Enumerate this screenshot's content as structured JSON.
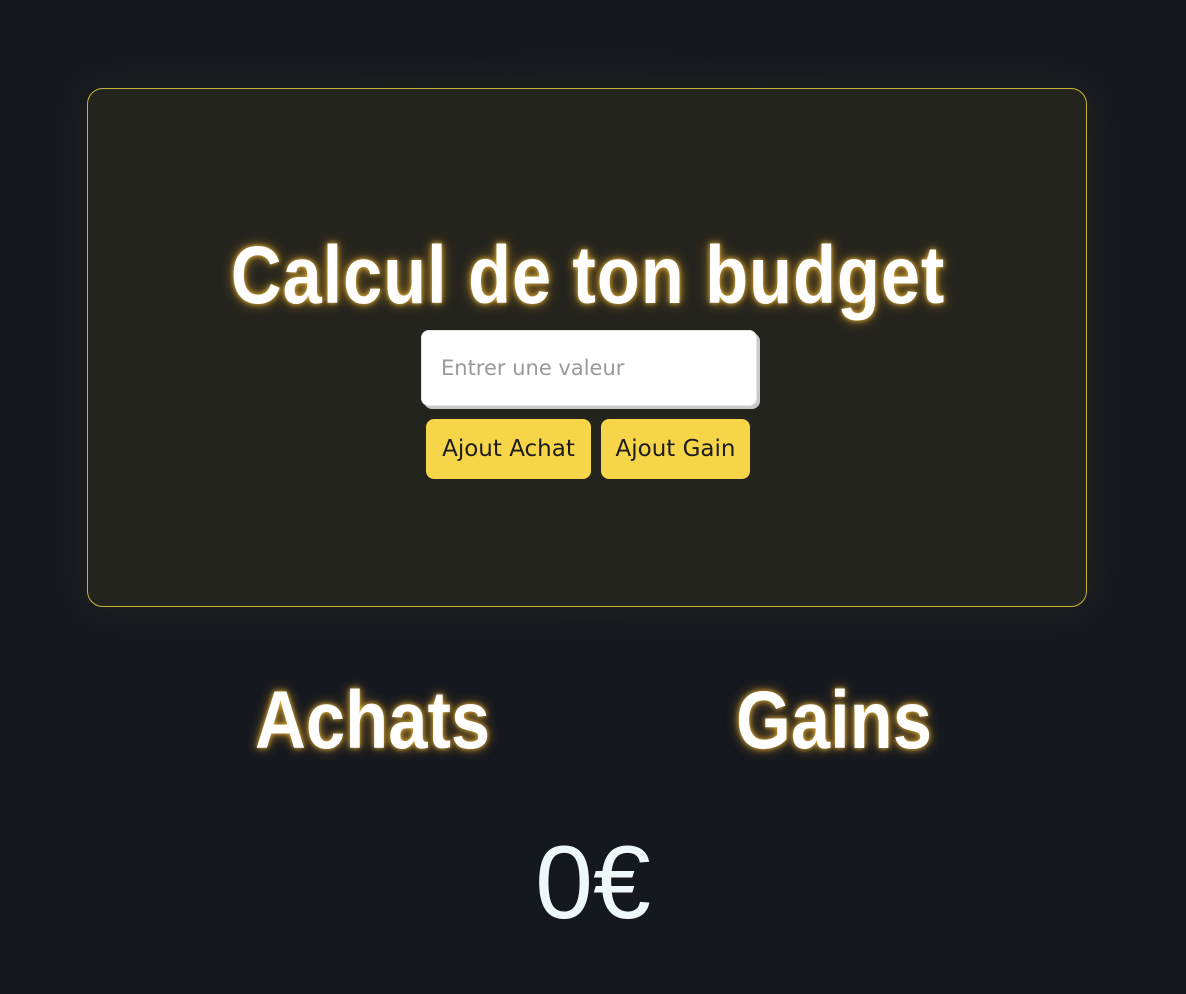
{
  "card": {
    "title": "Calcul de ton budget",
    "input_placeholder": "Entrer une valeur",
    "input_value": "",
    "button_achat": "Ajout Achat",
    "button_gain": "Ajout Gain"
  },
  "sections": {
    "achats_heading": "Achats",
    "gains_heading": "Gains"
  },
  "total": {
    "display": "0€"
  },
  "colors": {
    "background": "#15181f",
    "card_background": "#24241e",
    "card_border": "#c9b23a",
    "button": "#f7d549",
    "glow": "#ffc83c",
    "total_text": "#eef8fa"
  }
}
